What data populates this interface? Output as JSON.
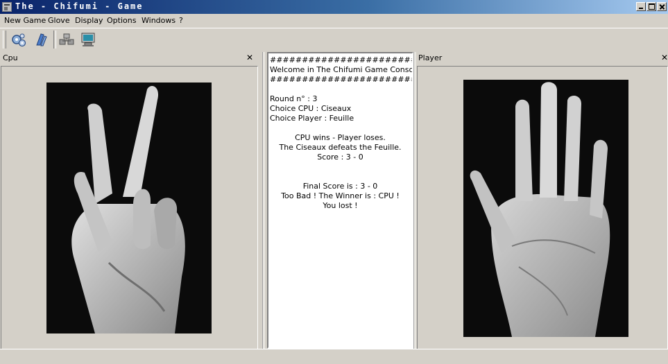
{
  "window": {
    "title": "The - Chifumi - Game"
  },
  "menu": {
    "items": [
      "New Game",
      "Glove",
      "Display",
      "Options",
      "Windows",
      "?"
    ]
  },
  "toolbar": {
    "icons": [
      "settings-gears-icon",
      "glove-icon",
      "network-icon",
      "computer-monitor-icon"
    ]
  },
  "cpu_pane": {
    "title": "Cpu",
    "close": "✕",
    "hand": "scissors"
  },
  "player_pane": {
    "title": "Player",
    "close": "✕",
    "hand": "paper"
  },
  "console": {
    "banner_top": "##########################",
    "welcome": "Welcome in The Chifumi Game Console",
    "banner_bottom": "##########################",
    "round": "Round n° : 3",
    "choice_cpu": "Choice CPU : Ciseaux",
    "choice_player": "Choice Player : Feuille",
    "result": "CPU wins - Player loses.",
    "defeat": "The Ciseaux defeats the Feuille.",
    "score": "Score : 3 - 0",
    "final_score": "Final Score is : 3 - 0",
    "winner": "Too Bad ! The Winner is : CPU !",
    "lost": "You lost !"
  },
  "colors": {
    "titlebar_start": "#0a246a",
    "titlebar_end": "#a6caf0",
    "face": "#d4d0c8"
  }
}
